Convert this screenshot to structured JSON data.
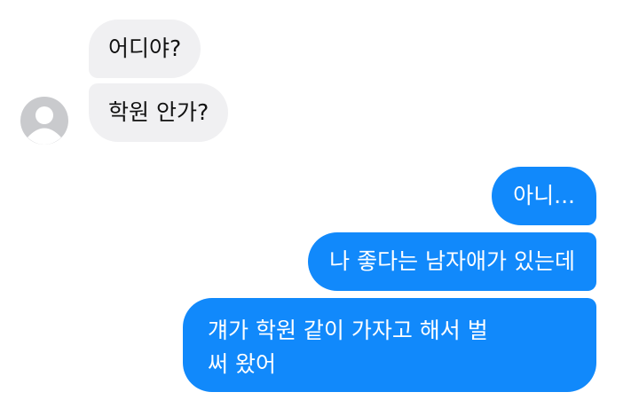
{
  "conversation": {
    "incoming": [
      {
        "text": "어디야?"
      },
      {
        "text": "학원 안가?"
      }
    ],
    "outgoing": [
      {
        "text": "아니..."
      },
      {
        "text": "나 좋다는 남자애가 있는데"
      },
      {
        "lines": [
          "걔가 학원 같이 가자고 해서 벌",
          "써 왔어"
        ]
      }
    ]
  },
  "icons": {
    "avatar": "default-profile-avatar-icon"
  },
  "colors": {
    "incoming_bubble": "#f0f0f2",
    "outgoing_bubble": "#1189fb",
    "incoming_text": "#111111",
    "outgoing_text": "#ffffff",
    "avatar": "#c9cacd"
  }
}
